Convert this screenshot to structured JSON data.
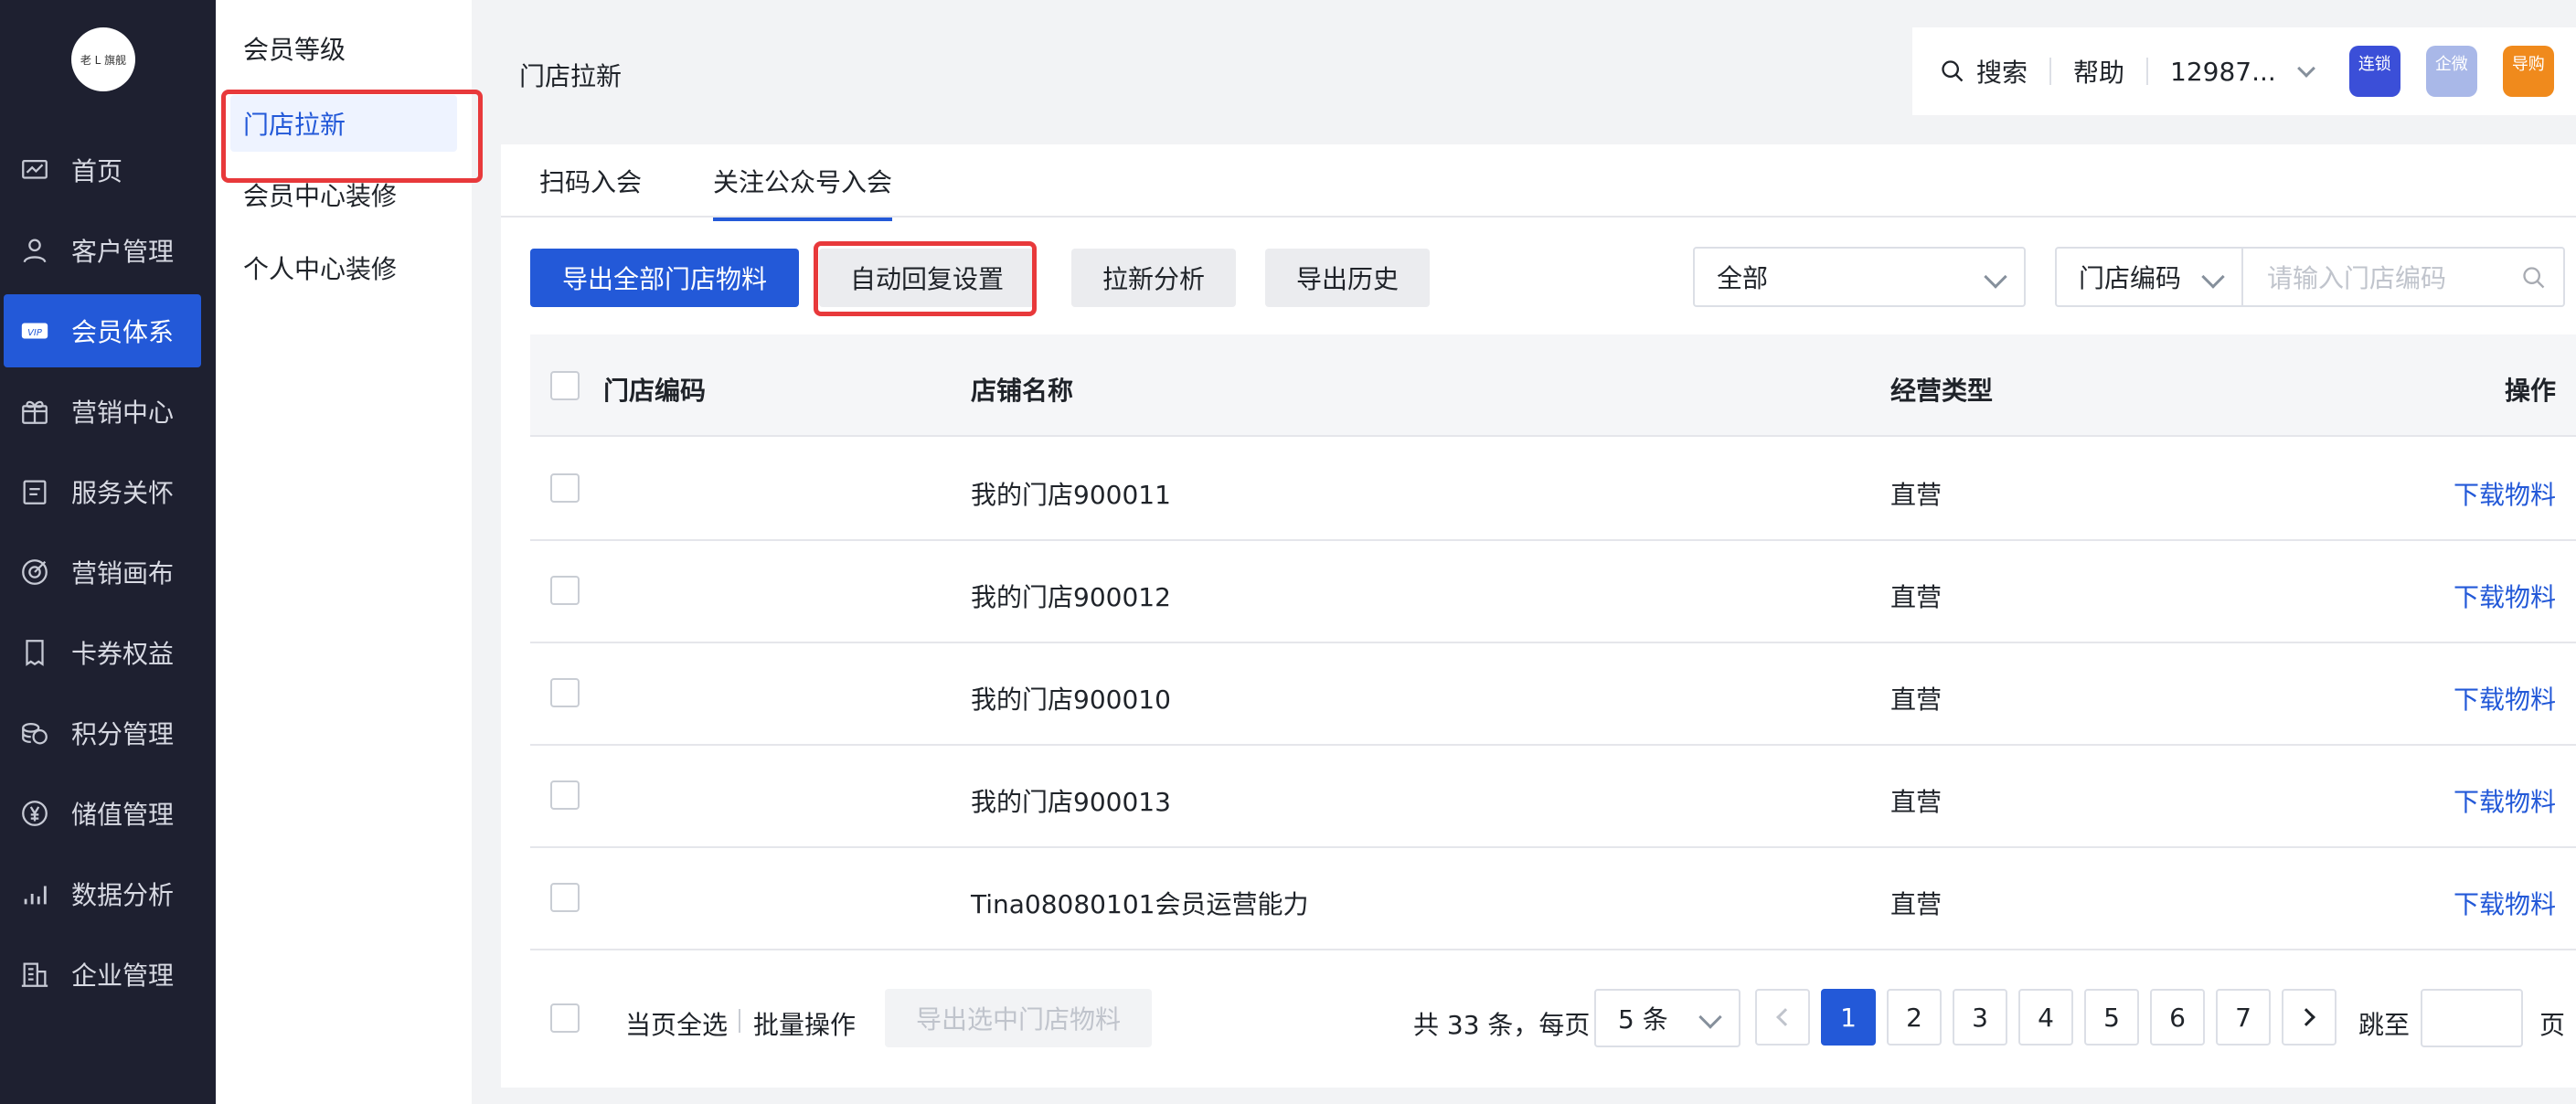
{
  "logo": {
    "text": "老 L 旗舰"
  },
  "nav": {
    "items": [
      {
        "label": "首页",
        "icon": "dashboard-icon"
      },
      {
        "label": "客户管理",
        "icon": "user-icon"
      },
      {
        "label": "会员体系",
        "icon": "vip-icon"
      },
      {
        "label": "营销中心",
        "icon": "gift-icon"
      },
      {
        "label": "服务关怀",
        "icon": "clipboard-icon"
      },
      {
        "label": "营销画布",
        "icon": "target-icon"
      },
      {
        "label": "卡券权益",
        "icon": "coupon-icon"
      },
      {
        "label": "积分管理",
        "icon": "coins-icon"
      },
      {
        "label": "储值管理",
        "icon": "yen-icon"
      },
      {
        "label": "数据分析",
        "icon": "bar-chart-icon"
      },
      {
        "label": "企业管理",
        "icon": "building-icon"
      }
    ],
    "active_index": 2
  },
  "submenu": {
    "items": [
      "会员等级",
      "门店拉新",
      "会员中心装修",
      "个人中心装修"
    ],
    "active_index": 1
  },
  "header": {
    "title": "门店拉新",
    "search_label": "搜索",
    "help_label": "帮助",
    "account": "12987...",
    "apps": [
      {
        "label": "连锁",
        "color": "#3b4fd8"
      },
      {
        "label": "企微",
        "color": "#a9b8e8"
      },
      {
        "label": "导购",
        "color": "#f08a1c"
      }
    ]
  },
  "tabs": [
    "扫码入会",
    "关注公众号入会"
  ],
  "active_tab": 1,
  "toolbar": {
    "export_all": "导出全部门店物料",
    "auto_reply": "自动回复设置",
    "analysis": "拉新分析",
    "export_history": "导出历史",
    "filter_value": "全部",
    "search_field": "门店编码",
    "search_placeholder": "请输入门店编码"
  },
  "table": {
    "columns": [
      "门店编码",
      "店铺名称",
      "经营类型",
      "操作"
    ],
    "rows": [
      {
        "code": "",
        "name": "我的门店900011",
        "type": "直营",
        "action": "下载物料"
      },
      {
        "code": "",
        "name": "我的门店900012",
        "type": "直营",
        "action": "下载物料"
      },
      {
        "code": "",
        "name": "我的门店900010",
        "type": "直营",
        "action": "下载物料"
      },
      {
        "code": "",
        "name": "我的门店900013",
        "type": "直营",
        "action": "下载物料"
      },
      {
        "code": "",
        "name": "Tina08080101会员运营能力",
        "type": "直营",
        "action": "下载物料"
      }
    ]
  },
  "footer": {
    "select_page": "当页全选",
    "batch": "批量操作",
    "export_selected": "导出选中门店物料",
    "total": "共 33 条，每页",
    "page_size": "5 条",
    "pages": [
      "1",
      "2",
      "3",
      "4",
      "5",
      "6",
      "7"
    ],
    "current_page": "1",
    "jump_label": "跳至",
    "page_suffix": "页"
  }
}
